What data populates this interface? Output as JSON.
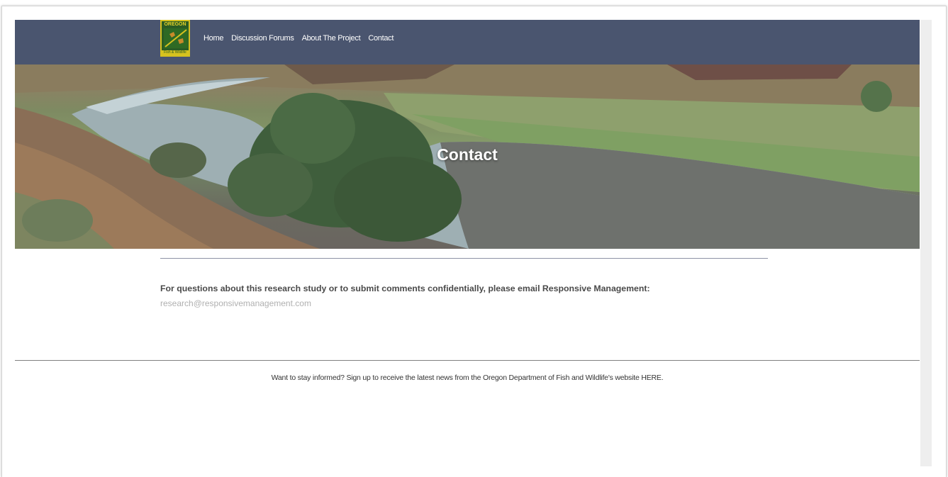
{
  "logo": {
    "top_text": "OREGON",
    "bottom_text": "Fish & Wildlife"
  },
  "nav": {
    "items": [
      {
        "label": "Home"
      },
      {
        "label": "Discussion Forums"
      },
      {
        "label": "About The Project"
      },
      {
        "label": "Contact"
      }
    ]
  },
  "hero": {
    "title": "Contact"
  },
  "main": {
    "intro_text": "For questions about this research study or to submit comments confidentially, please email Responsive Management:",
    "email": "research@responsivemanagement.com"
  },
  "footer": {
    "newsletter_text": "Want to stay informed? Sign up to receive the latest news from the Oregon Department of Fish and Wildlife's website HERE."
  },
  "colors": {
    "navbar": "#4a556f",
    "logo_green": "#2a5c23",
    "logo_gold": "#d6c21f"
  }
}
